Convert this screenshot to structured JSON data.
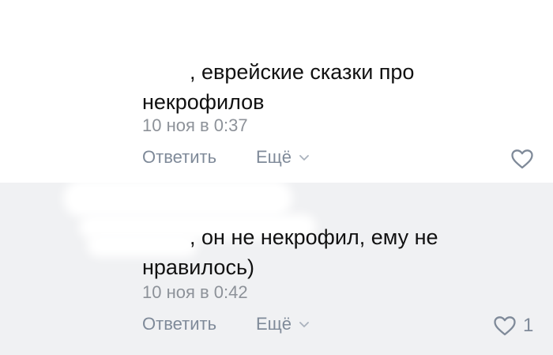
{
  "comments": [
    {
      "text": "        , еврейские сказки про некрофилов",
      "time": "10 ноя в 0:37",
      "reply_label": "Ответить",
      "more_label": "Ещё",
      "like_count": ""
    },
    {
      "text": "        , он не некрофил, ему не нравилось)",
      "time": "10 ноя в 0:42",
      "reply_label": "Ответить",
      "more_label": "Ещё",
      "like_count": "1"
    }
  ],
  "colors": {
    "text": "#111111",
    "meta": "#8d9299",
    "action": "#7f8a99",
    "highlight_bg": "#f0f1f3"
  },
  "icons": [
    "heart-icon",
    "chevron-down-icon"
  ]
}
